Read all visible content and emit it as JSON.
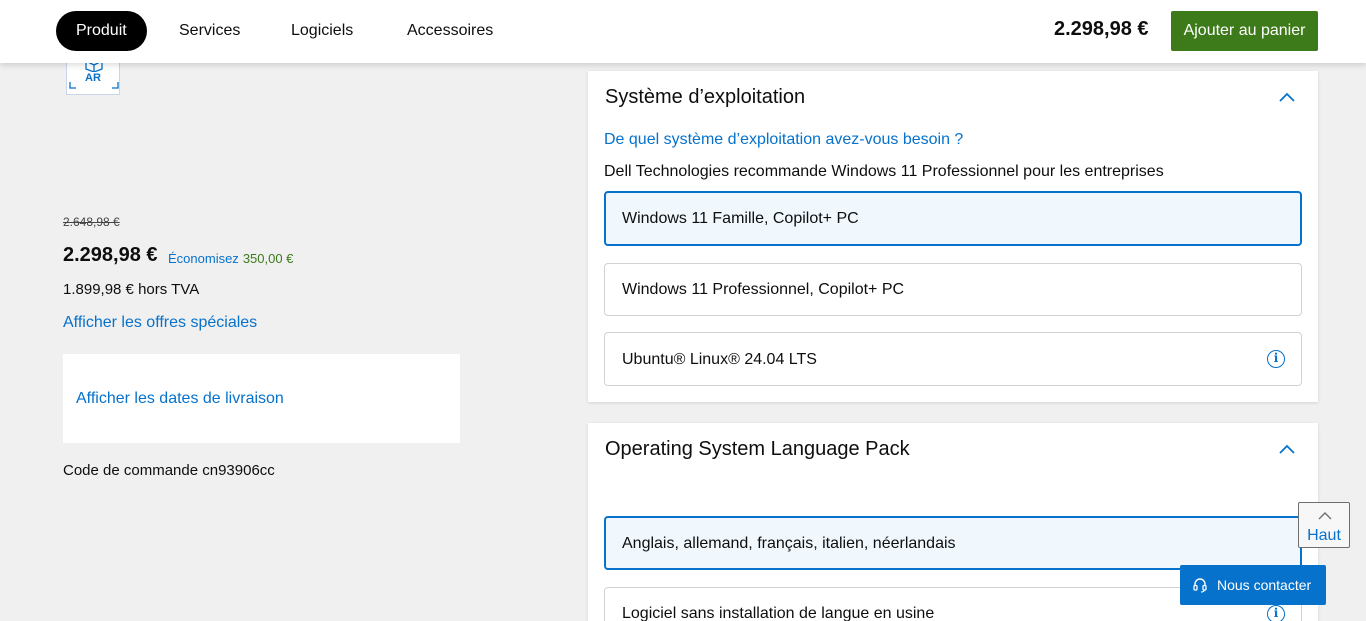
{
  "nav": {
    "tabs": [
      {
        "label": "Produit",
        "active": true
      },
      {
        "label": "Services",
        "active": false
      },
      {
        "label": "Logiciels",
        "active": false
      },
      {
        "label": "Accessoires",
        "active": false
      }
    ],
    "price": "2.298,98 €",
    "add_to_cart": "Ajouter au panier"
  },
  "product": {
    "ar_badge": "AR",
    "old_price": "2.648,98 €",
    "price": "2.298,98 €",
    "save_label": "Économisez",
    "save_amount": "350,00 €",
    "excl_vat": "1.899,98 € hors TVA",
    "offers_link": "Afficher les offres spéciales",
    "delivery_link": "Afficher les dates de livraison",
    "order_code": "Code de commande cn93906cc"
  },
  "os_section": {
    "title": "Système d’exploitation",
    "question": "De quel système d’exploitation avez-vous besoin ?",
    "recommendation": "Dell Technologies recommande Windows 11 Professionnel pour les entreprises",
    "options": [
      {
        "label": "Windows 11 Famille, Copilot+ PC",
        "selected": true,
        "info": false
      },
      {
        "label": "Windows 11 Professionnel, Copilot+ PC",
        "selected": false,
        "info": false
      },
      {
        "label": "Ubuntu® Linux® 24.04 LTS",
        "selected": false,
        "info": true
      }
    ]
  },
  "lang_section": {
    "title": "Operating System Language Pack",
    "options": [
      {
        "label": "Anglais, allemand, français, italien, néerlandais",
        "selected": true,
        "info": false
      },
      {
        "label": "Logiciel sans installation de langue en usine",
        "selected": false,
        "info": true
      }
    ]
  },
  "floating": {
    "top_label": "Haut",
    "contact_label": "Nous contacter"
  },
  "colors": {
    "accent_blue": "#0672cb",
    "cart_green": "#3d7a1a",
    "save_green": "#3d7a1a"
  },
  "icons": {
    "chevron": "chevron-up-icon",
    "info": "info-icon",
    "headset": "headset-icon",
    "arrow_up": "arrow-up-icon",
    "ar": "ar-cube-icon"
  }
}
